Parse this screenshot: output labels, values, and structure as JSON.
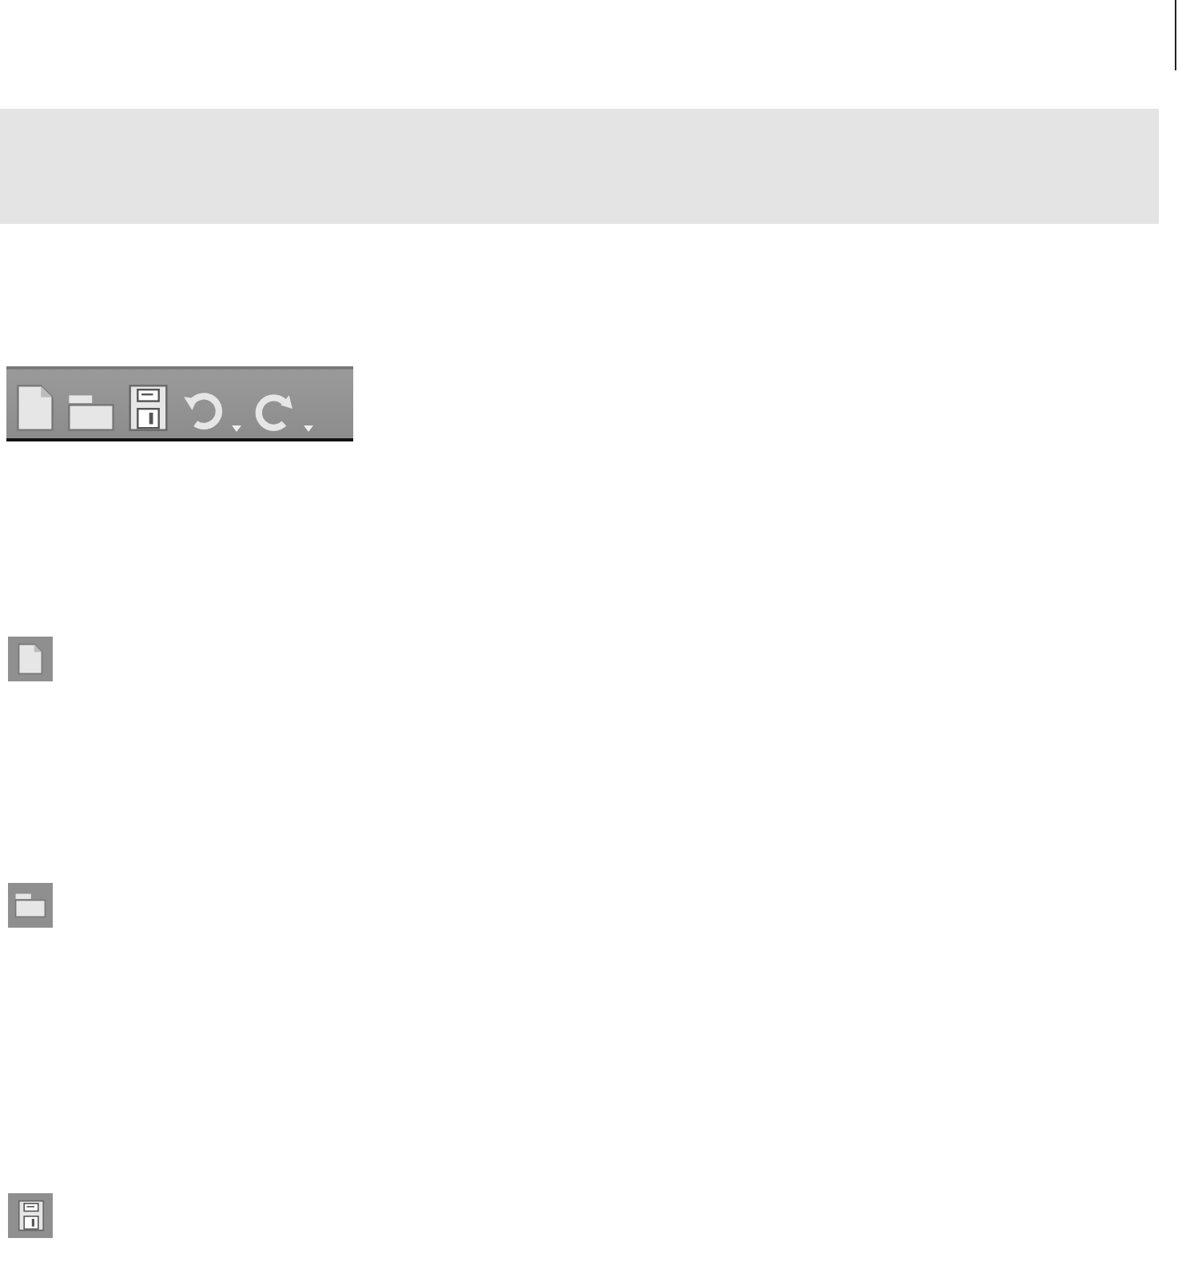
{
  "toolbar": {
    "buttons": [
      {
        "kind": "new"
      },
      {
        "kind": "open"
      },
      {
        "kind": "save"
      },
      {
        "kind": "undo",
        "dropdown": true
      },
      {
        "kind": "redo",
        "dropdown": true
      }
    ]
  },
  "icons": [
    {
      "kind": "new"
    },
    {
      "kind": "open"
    },
    {
      "kind": "save"
    }
  ]
}
